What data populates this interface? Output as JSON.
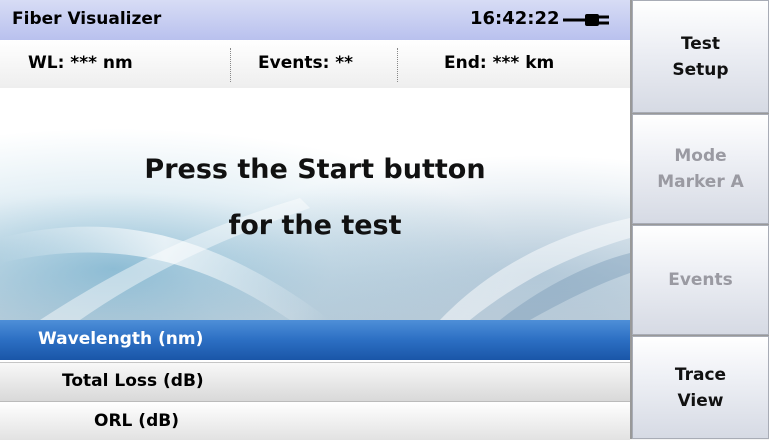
{
  "header": {
    "app_title": "Fiber Visualizer",
    "clock": "16:42:22",
    "power_icon": "plug-icon"
  },
  "info": {
    "wavelength": "WL: *** nm",
    "events": "Events: **",
    "end": "End: *** km"
  },
  "message": {
    "line1": "Press the Start button",
    "line2": "for the test"
  },
  "results": {
    "wavelength_label": "Wavelength (nm)",
    "total_loss_label": "Total Loss (dB)",
    "orl_label": "ORL (dB)"
  },
  "softkeys": {
    "test_setup": {
      "line1": "Test",
      "line2": "Setup",
      "enabled": true
    },
    "mode_marker": {
      "line1": "Mode",
      "line2": "Marker A",
      "enabled": false
    },
    "events": {
      "line1": "Events",
      "enabled": false
    },
    "trace_view": {
      "line1": "Trace",
      "line2": "View",
      "enabled": true
    }
  },
  "colors": {
    "titlebar": "#c8cef2",
    "selected_row": "#2c6fc3",
    "disabled_text": "#9a9aa2"
  }
}
